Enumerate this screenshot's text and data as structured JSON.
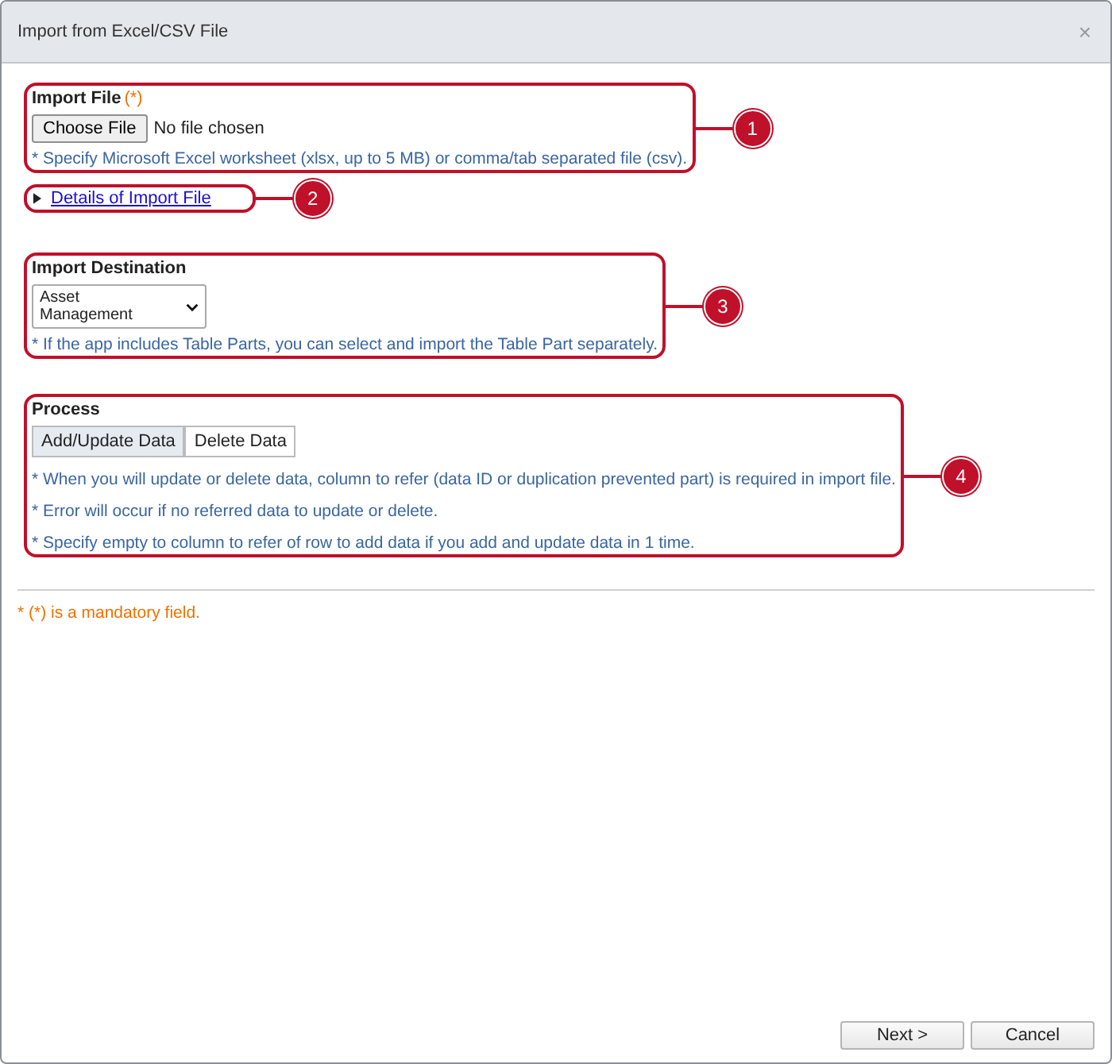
{
  "window": {
    "title": "Import from Excel/CSV File",
    "close": "×"
  },
  "import_file": {
    "label": "Import File",
    "required": "(*)",
    "button": "Choose File",
    "status": "No file chosen",
    "note": "* Specify Microsoft Excel worksheet (xlsx, up to 5 MB) or comma/tab separated file (csv).",
    "callout": "1"
  },
  "details": {
    "label": "Details of Import File",
    "expanded": false,
    "callout": "2"
  },
  "destination": {
    "label": "Import Destination",
    "value": "Asset Management",
    "note": "* If the app includes Table Parts, you can select and import the Table Part separately.",
    "callout": "3"
  },
  "process": {
    "label": "Process",
    "options": [
      {
        "label": "Add/Update Data",
        "selected": true
      },
      {
        "label": "Delete Data",
        "selected": false
      }
    ],
    "notes": [
      "* When you will update or delete data, column to refer (data ID or duplication prevented part) is required in import file.",
      "* Error will occur if no referred data to update or delete.",
      "* Specify empty to column to refer of row to add data if you add and update data in 1 time."
    ],
    "callout": "4"
  },
  "mandatory_note": "* (*) is a mandatory field.",
  "buttons": [
    "Next >",
    "Cancel"
  ]
}
